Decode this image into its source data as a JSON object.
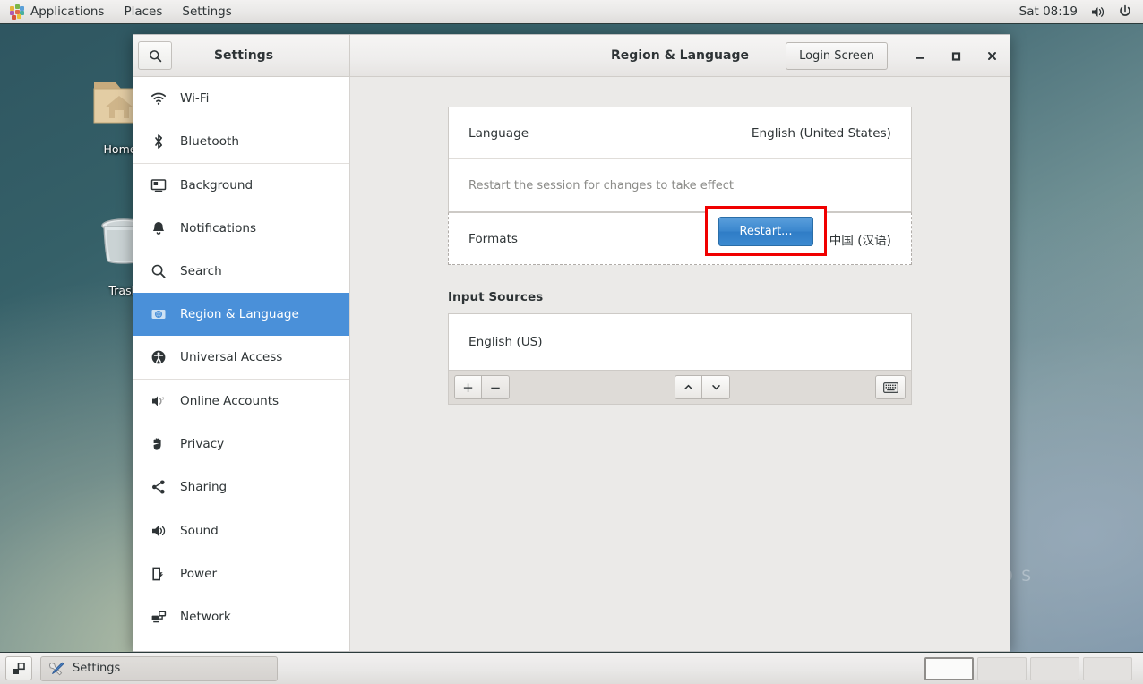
{
  "top_panel": {
    "applications_label": "Applications",
    "places_label": "Places",
    "settings_label": "Settings",
    "applications_icon": "applications-grid-icon",
    "clock": "Sat 08:19",
    "volume_icon": "volume-icon",
    "power_icon": "power-icon"
  },
  "desktop": {
    "icons": [
      {
        "label": "Home",
        "icon": "home-folder-icon"
      },
      {
        "label": "Trash",
        "icon": "trash-icon"
      }
    ],
    "wallpaper_text": "0 S"
  },
  "window": {
    "search_icon": "search-icon",
    "app_title": "Settings",
    "page_title": "Region & Language",
    "login_screen_label": "Login Screen",
    "minimize_icon": "minimize-icon",
    "maximize_icon": "maximize-icon",
    "close_icon": "close-icon"
  },
  "sidebar": {
    "items": [
      {
        "label": "Wi-Fi",
        "icon": "wifi-icon",
        "selected": false
      },
      {
        "label": "Bluetooth",
        "icon": "bluetooth-icon",
        "selected": false
      },
      {
        "label": "Background",
        "icon": "background-icon",
        "selected": false
      },
      {
        "label": "Notifications",
        "icon": "bell-icon",
        "selected": false
      },
      {
        "label": "Search",
        "icon": "search-icon",
        "selected": false
      },
      {
        "label": "Region & Language",
        "icon": "region-language-icon",
        "selected": true
      },
      {
        "label": "Universal Access",
        "icon": "accessibility-icon",
        "selected": false
      },
      {
        "label": "Online Accounts",
        "icon": "online-accounts-icon",
        "selected": false
      },
      {
        "label": "Privacy",
        "icon": "hand-icon",
        "selected": false
      },
      {
        "label": "Sharing",
        "icon": "share-icon",
        "selected": false
      },
      {
        "label": "Sound",
        "icon": "speaker-icon",
        "selected": false
      },
      {
        "label": "Power",
        "icon": "battery-icon",
        "selected": false
      },
      {
        "label": "Network",
        "icon": "network-icon",
        "selected": false
      }
    ]
  },
  "main": {
    "language_key": "Language",
    "language_value": "English (United States)",
    "restart_note": "Restart the session for changes to take effect",
    "restart_button": "Restart...",
    "formats_key": "Formats",
    "formats_value": "中国 (汉语)",
    "input_sources_label": "Input Sources",
    "input_sources": [
      "English (US)"
    ],
    "toolbar": {
      "add_label": "+",
      "remove_label": "−",
      "move_up_icon": "chevron-up-icon",
      "move_down_icon": "chevron-down-icon",
      "keyboard_icon": "keyboard-icon"
    },
    "highlight_color": "#f00000",
    "accent_color": "#4a90d9"
  },
  "taskbar": {
    "show_desktop_icon": "show-desktop-icon",
    "window_button_label": "Settings",
    "window_button_icon": "tools-icon",
    "workspaces": [
      {
        "active": true
      },
      {
        "active": false
      },
      {
        "active": false
      },
      {
        "active": false
      }
    ]
  }
}
